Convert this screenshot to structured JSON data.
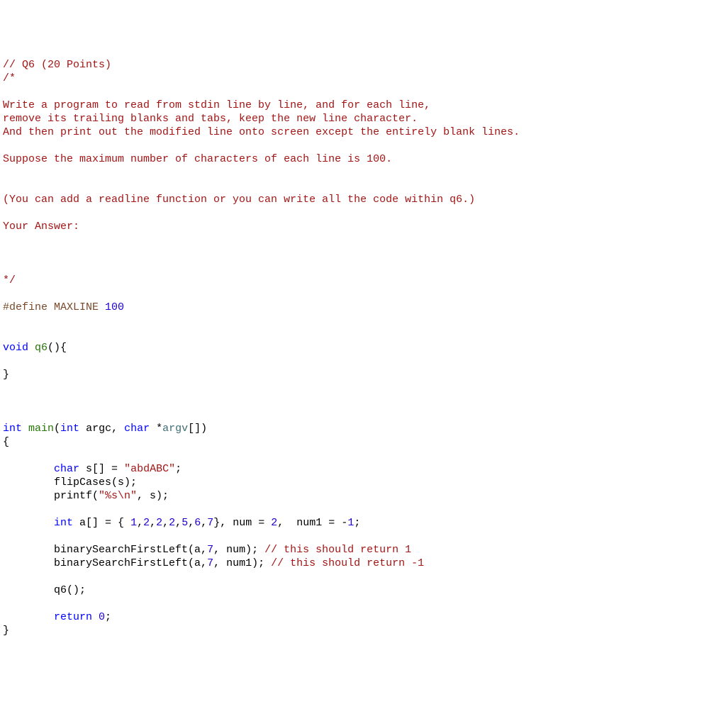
{
  "code": {
    "q6_header": "// Q6 (20 Points)",
    "cmt_open": "/*",
    "prompt_l1": "Write a program to read from stdin line by line, and for each line,",
    "prompt_l2": "remove its trailing blanks and tabs, keep the new line character.",
    "prompt_l3": "And then print out the modified line onto screen except the entirely blank lines.",
    "prompt_l4": "Suppose the maximum number of characters of each line is 100.",
    "prompt_l5": "(You can add a readline function or you can write all the code within q6.)",
    "prompt_l6": "Your Answer:",
    "cmt_close": "*/",
    "define_kw": "#define",
    "define_name": " MAXLINE ",
    "define_val": "100",
    "void_kw": "void",
    "q6_name": " q6",
    "q6_sig_tail": "(){",
    "brace_close": "}",
    "int_kw": "int",
    "main_name": " main",
    "main_open": "(",
    "argc_name": " argc",
    "comma_sp": ", ",
    "char_kw": "char",
    "star": " *",
    "argv_name": "argv",
    "main_close": "[])",
    "brace_open": "{",
    "indent": "        ",
    "s_decl_a": " s",
    "s_decl_b": "[] = ",
    "s_str": "\"abdABC\"",
    "semi": ";",
    "flip_call": "flipCases(s);",
    "printf_a": "printf(",
    "printf_fmt": "\"%s\\n\"",
    "printf_b": ", s);",
    "a_decl_a": " a",
    "a_decl_b": "[] = { ",
    "n1": "1",
    "n2": "2",
    "n3": "2",
    "n4": "2",
    "n5": "5",
    "n6": "6",
    "n7": "7",
    "a_decl_c": "}, num = ",
    "num_v": "2",
    "a_decl_d": ",  num1 = ",
    "neg": "-",
    "one": "1",
    "bs1_a": "binarySearchFirstLeft(a,",
    "bs_seven": "7",
    "bs1_b": ", num); ",
    "bs1_c": "// this should return 1",
    "bs2_b": ", num1); ",
    "bs2_c": "// this should return -1",
    "q6_call": "q6();",
    "return_kw": "return",
    "zero": " 0",
    "cs": ", "
  }
}
